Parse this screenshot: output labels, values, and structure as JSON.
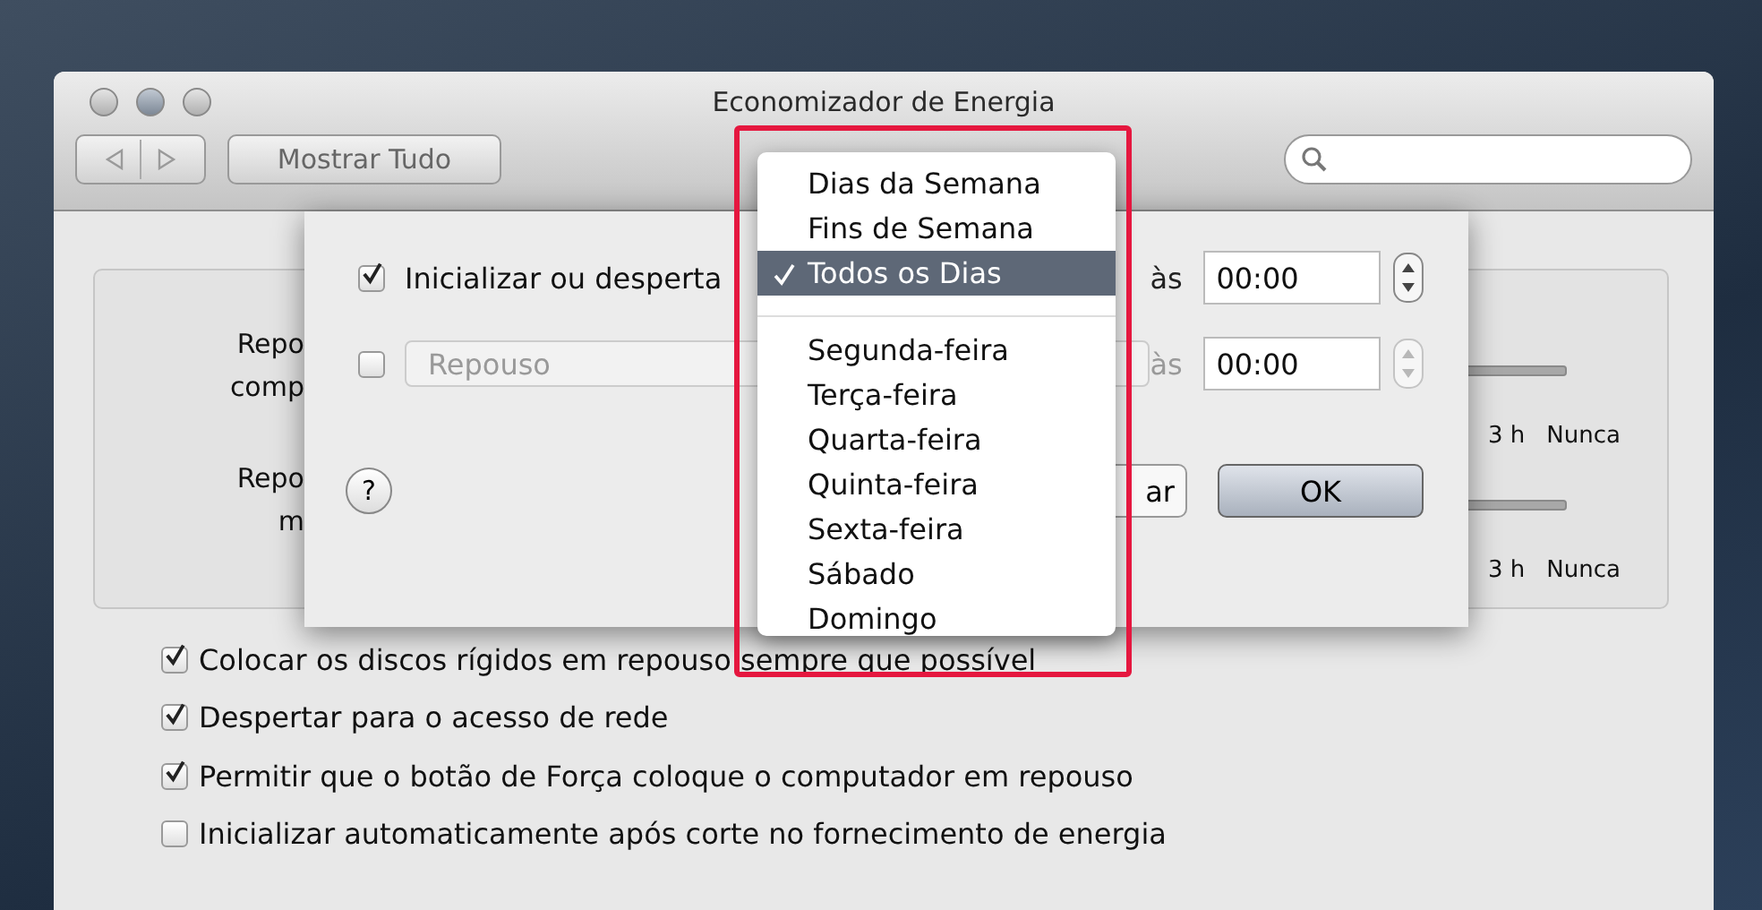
{
  "window": {
    "title": "Economizador de Energia",
    "show_all_button": "Mostrar Tudo"
  },
  "sleep_settings": [
    {
      "label_lines": [
        "Repo",
        "comp"
      ],
      "tick_labels": [
        "3 h",
        "Nunca"
      ]
    },
    {
      "label_lines": [
        "Repo",
        "m"
      ],
      "tick_labels": [
        "3 h",
        "Nunca"
      ]
    }
  ],
  "options": [
    {
      "label": "Colocar os discos rígidos em repouso sempre que possível",
      "checked": true
    },
    {
      "label": "Despertar para o acesso de rede",
      "checked": true
    },
    {
      "label": "Permitir que o botão de Força coloque o computador em repouso",
      "checked": true
    },
    {
      "label": "Inicializar automaticamente após corte no fornecimento de energia",
      "checked": false
    }
  ],
  "schedule_sheet": {
    "rows": [
      {
        "kind": "label",
        "checked": true,
        "text": "Inicializar ou desperta",
        "at": "às",
        "time": "00:00",
        "disabled": false
      },
      {
        "kind": "popup",
        "checked": false,
        "text": "Repouso",
        "at": "às",
        "time": "00:00",
        "disabled": true
      }
    ],
    "help_button": "?",
    "cancel_button": "ar",
    "ok_button": "OK"
  },
  "popup_menu": {
    "items": [
      {
        "kind": "item",
        "label": "Dias da Semana",
        "selected": false
      },
      {
        "kind": "item",
        "label": "Fins de Semana",
        "selected": false
      },
      {
        "kind": "item",
        "label": "Todos os Dias",
        "selected": true
      },
      {
        "kind": "separator"
      },
      {
        "kind": "item",
        "label": "Segunda-feira",
        "selected": false
      },
      {
        "kind": "item",
        "label": "Terça-feira",
        "selected": false
      },
      {
        "kind": "item",
        "label": "Quarta-feira",
        "selected": false
      },
      {
        "kind": "item",
        "label": "Quinta-feira",
        "selected": false
      },
      {
        "kind": "item",
        "label": "Sexta-feira",
        "selected": false
      },
      {
        "kind": "item",
        "label": "Sábado",
        "selected": false
      },
      {
        "kind": "item",
        "label": "Domingo",
        "selected": false
      }
    ]
  }
}
